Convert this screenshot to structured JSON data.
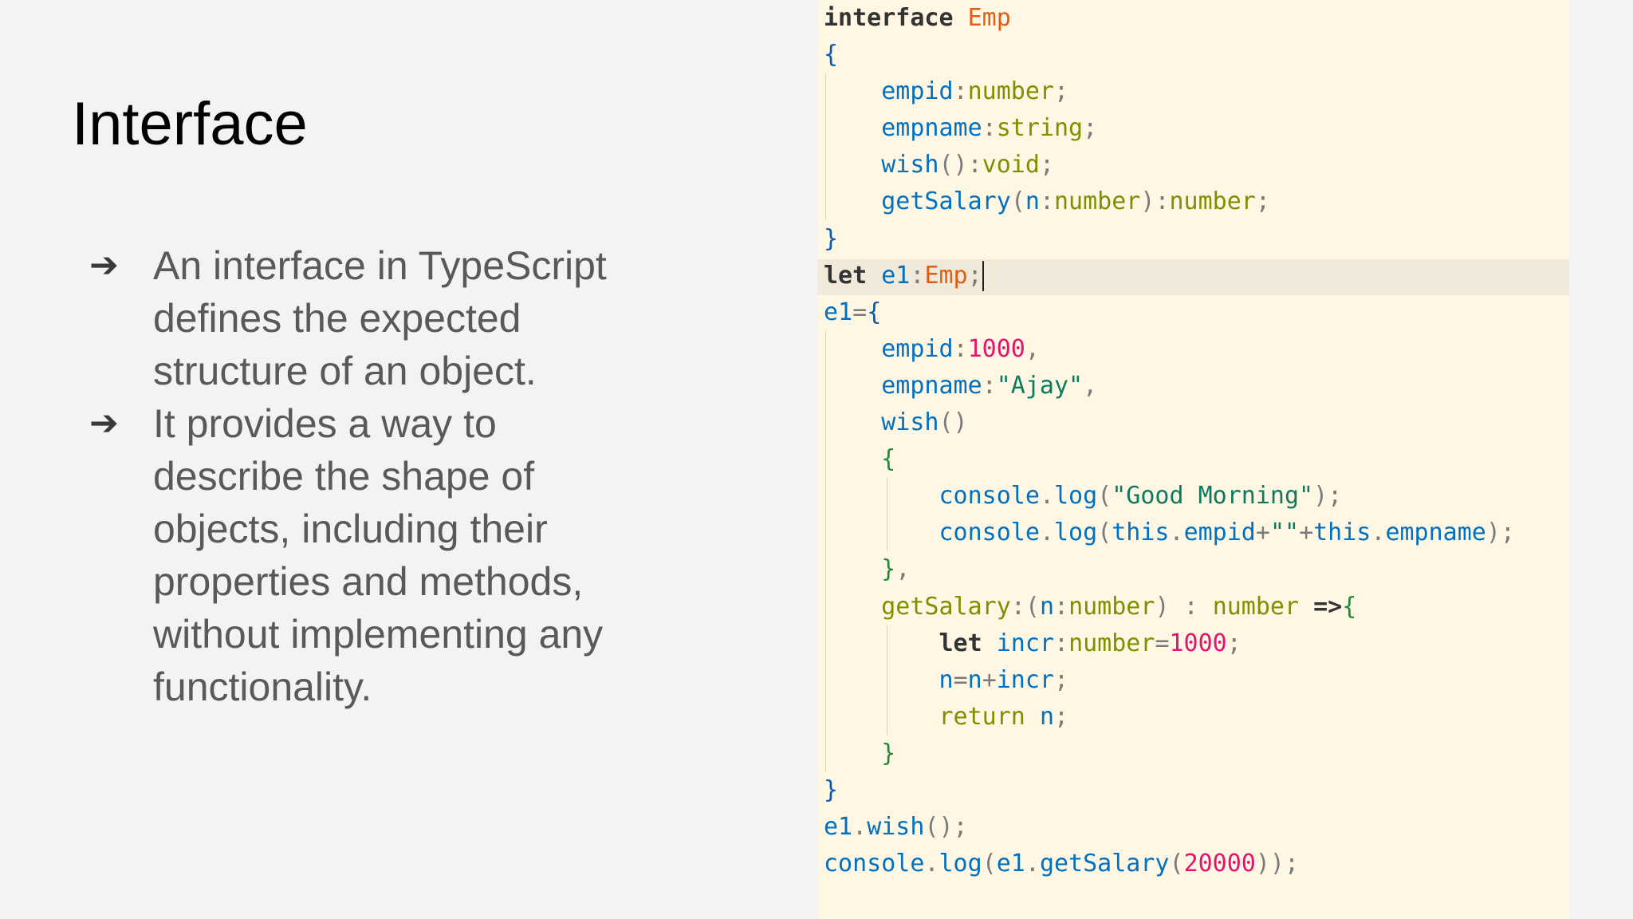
{
  "slide": {
    "title": "Interface",
    "bullets": [
      {
        "arrow": "➔",
        "lines": [
          "An interface in TypeScript",
          "defines the expected",
          "structure of an object."
        ]
      },
      {
        "arrow": "➔",
        "lines": [
          "It provides a way to",
          "describe the shape of",
          "objects, including their",
          "properties and methods,",
          "without implementing any",
          "functionality."
        ]
      }
    ]
  },
  "code": {
    "language": "TypeScript",
    "highlighted_line": 8,
    "lines": [
      "interface Emp",
      "{",
      "    empid:number;",
      "    empname:string;",
      "    wish():void;",
      "    getSalary(n:number):number;",
      "}",
      "let e1:Emp;",
      "e1={",
      "    empid:1000,",
      "    empname:\"Ajay\",",
      "    wish()",
      "    {",
      "        console.log(\"Good Morning\");",
      "        console.log(this.empid+\"\"+this.empname);",
      "    },",
      "    getSalary:(n:number) : number =>{",
      "        let incr:number=1000;",
      "        n=n+incr;",
      "        return n;",
      "    }",
      "}",
      "e1.wish();",
      "console.log(e1.getSalary(20000));"
    ]
  },
  "colors": {
    "background": "#f3f3f3",
    "code_background": "#fff7e4",
    "keyword": "#333333",
    "type_name": "#e25c12",
    "identifier": "#0070c1",
    "type_annotation": "#7f8f00",
    "string": "#0c7a5f",
    "number": "#e1156d"
  }
}
